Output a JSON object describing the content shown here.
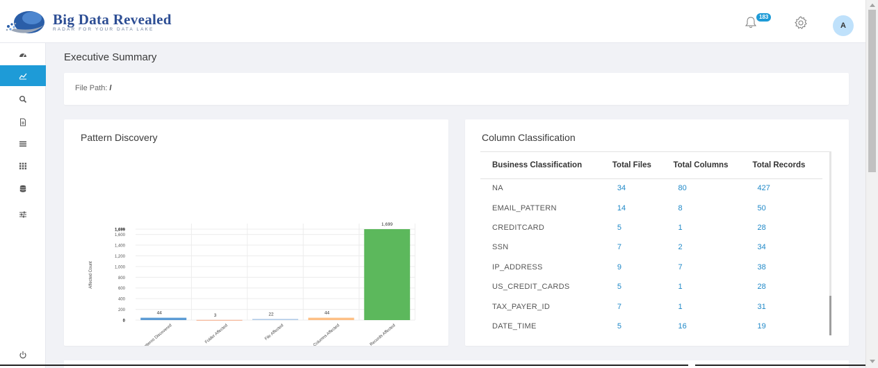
{
  "app": {
    "brand_title": "Big Data Revealed",
    "brand_subtitle": "RADAR FOR YOUR DATA LAKE"
  },
  "header": {
    "notification_count": "183",
    "avatar_initial": "A"
  },
  "sidebar": {
    "items": [
      {
        "icon": "dashboard-icon"
      },
      {
        "icon": "line-chart-icon",
        "active": true
      },
      {
        "icon": "search-icon"
      },
      {
        "icon": "document-icon"
      },
      {
        "icon": "list-icon"
      },
      {
        "icon": "grid-icon"
      },
      {
        "icon": "database-icon"
      },
      {
        "icon": "sliders-icon"
      }
    ],
    "bottom_icon": "power-icon"
  },
  "page": {
    "title": "Executive Summary",
    "file_path_label": "File Path:",
    "file_path_value": "/"
  },
  "pattern_card": {
    "title": "Pattern Discovery"
  },
  "chart_data": {
    "type": "bar",
    "title": "",
    "xlabel": "",
    "ylabel": "Affected Count",
    "categories": [
      "Patterns Discovered",
      "Folder Affected",
      "File Affected",
      "Columns Affected",
      "Records Affected"
    ],
    "values": [
      44,
      3,
      22,
      44,
      1699
    ],
    "value_labels": [
      "44",
      "3",
      "22",
      "44",
      "1,699"
    ],
    "colors": [
      "#5b9bd5",
      "#f4a582",
      "#b4cde8",
      "#fdbf85",
      "#5cb85c"
    ],
    "yticks": [
      "0",
      "200",
      "400",
      "600",
      "800",
      "1,000",
      "1,200",
      "1,400",
      "1,600",
      "1,699"
    ],
    "ytick_values": [
      0,
      200,
      400,
      600,
      800,
      1000,
      1200,
      1400,
      1600,
      1699
    ],
    "ylim": [
      0,
      1699
    ],
    "grid": true
  },
  "column_card": {
    "title": "Column Classification",
    "headers": [
      "Business Classification",
      "Total Files",
      "Total Columns",
      "Total Records"
    ],
    "rows": [
      [
        "NA",
        "34",
        "80",
        "427"
      ],
      [
        "EMAIL_PATTERN",
        "14",
        "8",
        "50"
      ],
      [
        "CREDITCARD",
        "5",
        "1",
        "28"
      ],
      [
        "SSN",
        "7",
        "2",
        "34"
      ],
      [
        "IP_ADDRESS",
        "9",
        "7",
        "38"
      ],
      [
        "US_CREDIT_CARDS",
        "5",
        "1",
        "28"
      ],
      [
        "TAX_PAYER_ID",
        "7",
        "1",
        "31"
      ],
      [
        "DATE_TIME",
        "5",
        "16",
        "19"
      ]
    ]
  }
}
